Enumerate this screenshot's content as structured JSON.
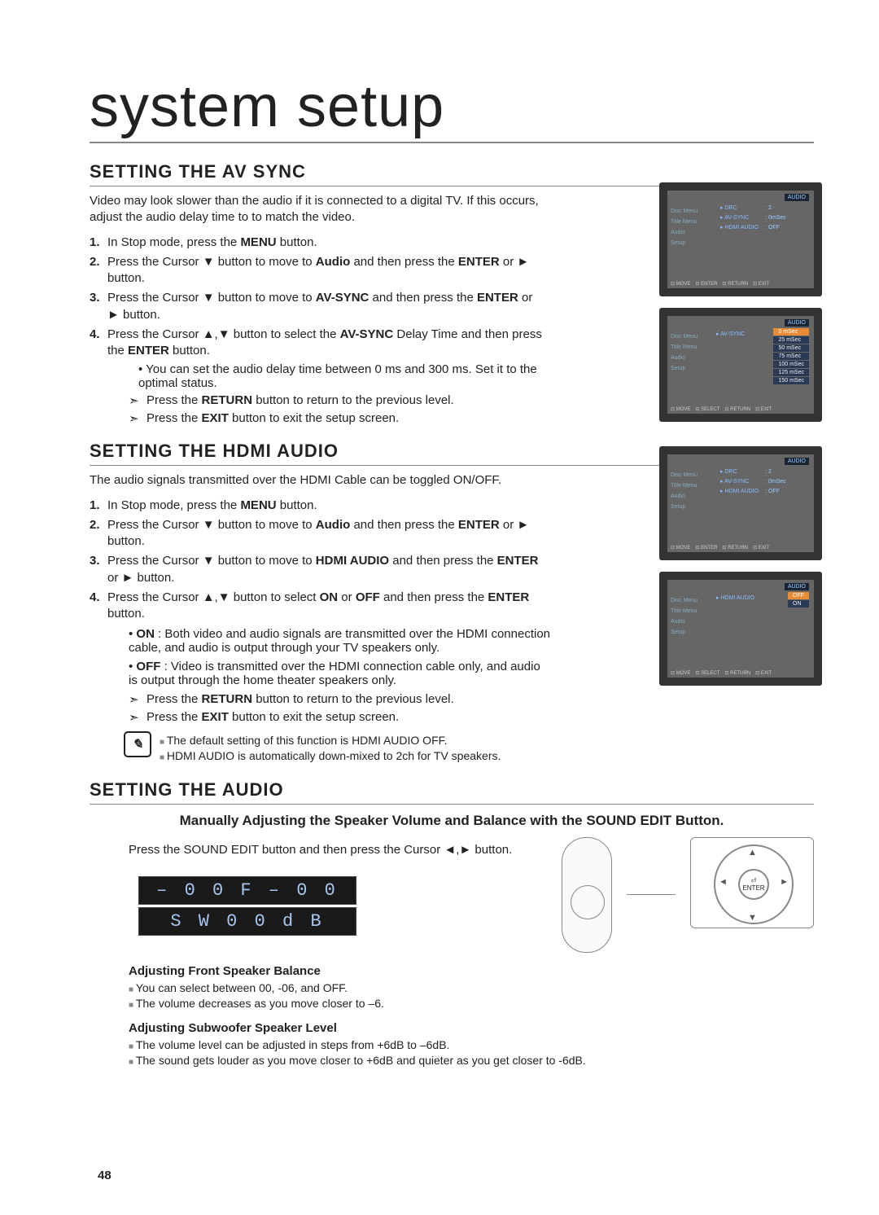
{
  "page_number": "48",
  "main_title": "system setup",
  "avsync": {
    "heading": "SETTING THE AV SYNC",
    "intro": "Video may look slower than the audio if it is connected to a digital TV. If this occurs, adjust the audio delay time to to match the video.",
    "steps": [
      "In Stop mode, press the MENU button.",
      "Press the Cursor ▼ button to move to Audio and then press the ENTER or ► button.",
      "Press the Cursor ▼ button to move to AV-SYNC and then press the ENTER or ► button.",
      "Press the Cursor ▲,▼ button to select the AV-SYNC Delay Time and then press the ENTER button."
    ],
    "bullets": [
      "You can set the audio delay time between 0 ms and 300 ms. Set it to the optimal status."
    ],
    "arrows": [
      "Press the RETURN button to return to the previous level.",
      "Press the EXIT button to exit the setup screen."
    ]
  },
  "hdmi": {
    "heading": "SETTING THE HDMI AUDIO",
    "intro": "The audio signals transmitted over the HDMI Cable can be toggled ON/OFF.",
    "steps": [
      "In Stop mode, press the MENU button.",
      "Press the Cursor  ▼ button to move to Audio and then press the ENTER or ► button.",
      "Press the Cursor ▼ button to move to HDMI AUDIO and then press the ENTER or ► button.",
      "Press the Cursor ▲,▼ button to select ON or OFF and then press the ENTER button."
    ],
    "onoff": [
      "ON : Both video and audio signals are transmitted over the HDMI connection cable, and audio is output through your TV speakers only.",
      "OFF : Video is transmitted over the HDMI connection cable only, and audio is output through the home theater speakers only."
    ],
    "arrows": [
      "Press the RETURN button to return to the previous level.",
      "Press the EXIT button to exit the setup screen."
    ],
    "notes": [
      "The default setting of this function is HDMI AUDIO OFF.",
      "HDMI AUDIO is automatically down-mixed to 2ch for TV speakers."
    ]
  },
  "audio": {
    "heading": "SETTING THE AUDIO",
    "subtitle": "Manually Adjusting the Speaker Volume and Balance with the SOUND EDIT Button.",
    "press": "Press the SOUND EDIT button and then press the Cursor ◄,► button.",
    "lcd": [
      "– 0 0   F     – 0 0",
      "S W       0 0 d B"
    ],
    "front": {
      "title": "Adjusting Front Speaker Balance",
      "lines": [
        "You can select between 00, -06, and OFF.",
        "The volume decreases as you move closer to –6."
      ]
    },
    "sub": {
      "title": "Adjusting Subwoofer Speaker Level",
      "lines": [
        "The volume level can be adjusted in steps from +6dB to –6dB.",
        "The sound gets louder as you move closer to +6dB and quieter as you get closer to -6dB."
      ]
    }
  },
  "screensA": [
    {
      "hdr": "AUDIO",
      "left": [
        "Disc Menu",
        "Title Menu",
        "Audio",
        "Setup"
      ],
      "rows": [
        [
          "▸ DRC",
          ": 2"
        ],
        [
          "▸ AV-SYNC",
          ": 0mSec"
        ],
        [
          "▸ HDMI AUDIO",
          ": OFF"
        ]
      ],
      "foot": [
        "MOVE",
        "ENTER",
        "RETURN",
        "EXIT"
      ]
    },
    {
      "hdr": "AUDIO",
      "left": [
        "Disc Menu",
        "Title Menu",
        "Audio",
        "Setup"
      ],
      "label": "▸ AV-SYNC",
      "opts": [
        "0 mSec",
        "25 mSec",
        "50 mSec",
        "75 mSec",
        "100 mSec",
        "125 mSec",
        "150 mSec"
      ],
      "sel": 0,
      "foot": [
        "MOVE",
        "SELECT",
        "RETURN",
        "EXIT"
      ]
    }
  ],
  "screensB": [
    {
      "hdr": "AUDIO",
      "left": [
        "Disc Menu",
        "Title Menu",
        "Audio",
        "Setup"
      ],
      "rows": [
        [
          "▸ DRC",
          ": 2"
        ],
        [
          "▸ AV-SYNC",
          ": 0mSec"
        ],
        [
          "▸ HDMI AUDIO",
          ": OFF"
        ]
      ],
      "foot": [
        "MOVE",
        "ENTER",
        "RETURN",
        "EXIT"
      ]
    },
    {
      "hdr": "AUDIO",
      "left": [
        "Disc Menu",
        "Title Menu",
        "Audio",
        "Setup"
      ],
      "label": "▸ HDMI AUDIO",
      "opts": [
        "OFF",
        "ON"
      ],
      "sel": 0,
      "foot": [
        "MOVE",
        "SELECT",
        "RETURN",
        "EXIT"
      ]
    }
  ],
  "dpad": {
    "center": "ENTER"
  }
}
